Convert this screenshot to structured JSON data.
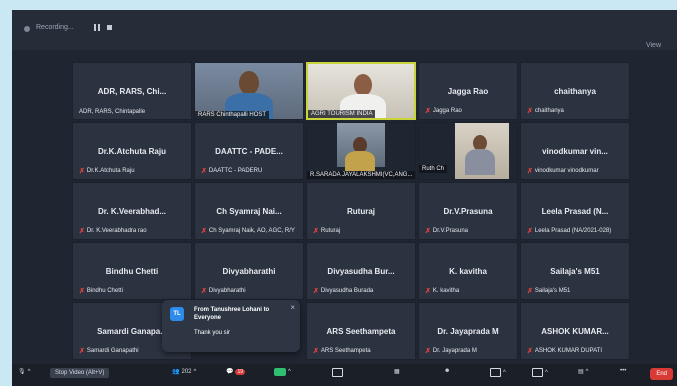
{
  "topbar": {
    "recording_label": "Recording...",
    "view_label": "View"
  },
  "tiles": [
    {
      "id": "adr",
      "big": "ADR, RARS, Chi...",
      "sub": "ADR, RARS, Chintapalle",
      "muted": false
    },
    {
      "id": "rars-video",
      "strip": "RARS Chinthapalli HOST"
    },
    {
      "id": "agri-video",
      "strip": "AGRI TOURISM INDIA"
    },
    {
      "id": "jagga",
      "big": "Jagga Rao",
      "sub": "Jagga Rao",
      "muted": true
    },
    {
      "id": "chaithanya",
      "big": "chaithanya",
      "sub": "chaithanya",
      "muted": true
    },
    {
      "id": "achutaraju",
      "big": "Dr.K.Atchuta Raju",
      "sub": "Dr.K.Atchuta Raju",
      "muted": true
    },
    {
      "id": "daattc",
      "big": "DAATTC - PADE...",
      "sub": "DAATTC - PADERU",
      "muted": true
    },
    {
      "id": "sarada-video",
      "strip": "R.SARADA JAYALAKSHMI(VC,ANG..."
    },
    {
      "id": "ruth-video",
      "strip": "Ruth Ch"
    },
    {
      "id": "vinodkumar",
      "big": "vinodkumar vin...",
      "sub": "vinodkumar vinodkumar",
      "muted": true
    },
    {
      "id": "veerabhadra",
      "big": "Dr. K.Veerabhad...",
      "sub": "Dr. K.Veerabhadra rao",
      "muted": true
    },
    {
      "id": "syamraj",
      "big": "Ch Syamraj Nai...",
      "sub": "Ch Syamraj Naik, AO, AGC, R/Y",
      "muted": true
    },
    {
      "id": "ruturaj",
      "big": "Ruturaj",
      "sub": "Ruturaj",
      "muted": true
    },
    {
      "id": "prasuna",
      "big": "Dr.V.Prasuna",
      "sub": "Dr.V.Prasuna",
      "muted": true
    },
    {
      "id": "leela",
      "big": "Leela Prasad (N...",
      "sub": "Leela Prasad (NA/2021-028)",
      "muted": true
    },
    {
      "id": "bindhu",
      "big": "Bindhu Chetti",
      "sub": "Bindhu Chetti",
      "muted": true
    },
    {
      "id": "divya",
      "big": "Divyabharathi",
      "sub": "Divyabharathi",
      "muted": true
    },
    {
      "id": "divyasudha",
      "big": "Divyasudha Bur...",
      "sub": "Divyasudha Burada",
      "muted": true
    },
    {
      "id": "kavitha",
      "big": "K. kavitha",
      "sub": "K. kavitha",
      "muted": true
    },
    {
      "id": "sailaja",
      "big": "Sailaja's M51",
      "sub": "Sailaja's M51",
      "muted": true
    },
    {
      "id": "samardi",
      "big": "Samardi Ganapa...",
      "sub": "Samardi Ganapathi",
      "muted": true
    },
    {
      "id": "seethampeta",
      "big": "ARS Seethampeta",
      "sub": "ARS Seethampeta",
      "muted": true
    },
    {
      "id": "jayaprada",
      "big": "Dr. Jayaprada M",
      "sub": "Dr. Jayaprada M",
      "muted": true
    },
    {
      "id": "ashok",
      "big": "ASHOK KUMAR...",
      "sub": "ASHOK KUMAR DUPATI",
      "muted": true
    }
  ],
  "chat": {
    "avatar": "TL",
    "from": "From Tanushree Lohani to Everyone",
    "message": "Thank you sir"
  },
  "toolbar": {
    "stop_video": "Stop Video (Alt+V)",
    "participants_count": "202",
    "chat_badge": "19",
    "end": "End"
  },
  "colors": {
    "background": "#1f2631",
    "tile": "#2b3240",
    "speaking_border": "#c9d33a",
    "mute": "#e0443e",
    "end_button": "#d93a36"
  }
}
